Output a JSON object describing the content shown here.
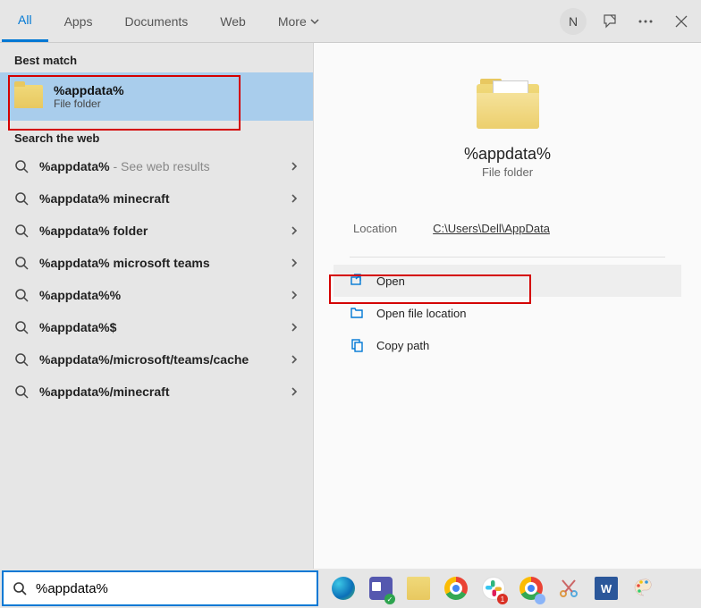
{
  "tabs": {
    "all": "All",
    "apps": "Apps",
    "documents": "Documents",
    "web": "Web",
    "more": "More"
  },
  "avatar_initial": "N",
  "sections": {
    "best_match": "Best match",
    "search_web": "Search the web"
  },
  "best_match": {
    "title": "%appdata%",
    "subtitle": "File folder"
  },
  "web_results": [
    {
      "prefix": "%appdata%",
      "suffix": "",
      "hint": " - See web results"
    },
    {
      "prefix": "%appdata%",
      "suffix": " minecraft",
      "hint": ""
    },
    {
      "prefix": "%appdata%",
      "suffix": " folder",
      "hint": ""
    },
    {
      "prefix": "%appdata%",
      "suffix": " microsoft teams",
      "hint": ""
    },
    {
      "prefix": "%appdata%",
      "suffix": "%",
      "hint": ""
    },
    {
      "prefix": "%appdata%",
      "suffix": "$",
      "hint": ""
    },
    {
      "prefix": "%appdata%",
      "suffix": "/microsoft/teams/cache",
      "hint": ""
    },
    {
      "prefix": "%appdata%",
      "suffix": "/minecraft",
      "hint": ""
    }
  ],
  "preview": {
    "title": "%appdata%",
    "subtitle": "File folder",
    "location_label": "Location",
    "location_value": "C:\\Users\\Dell\\AppData",
    "actions": {
      "open": "Open",
      "open_location": "Open file location",
      "copy_path": "Copy path"
    }
  },
  "search": {
    "value": "%appdata%"
  }
}
